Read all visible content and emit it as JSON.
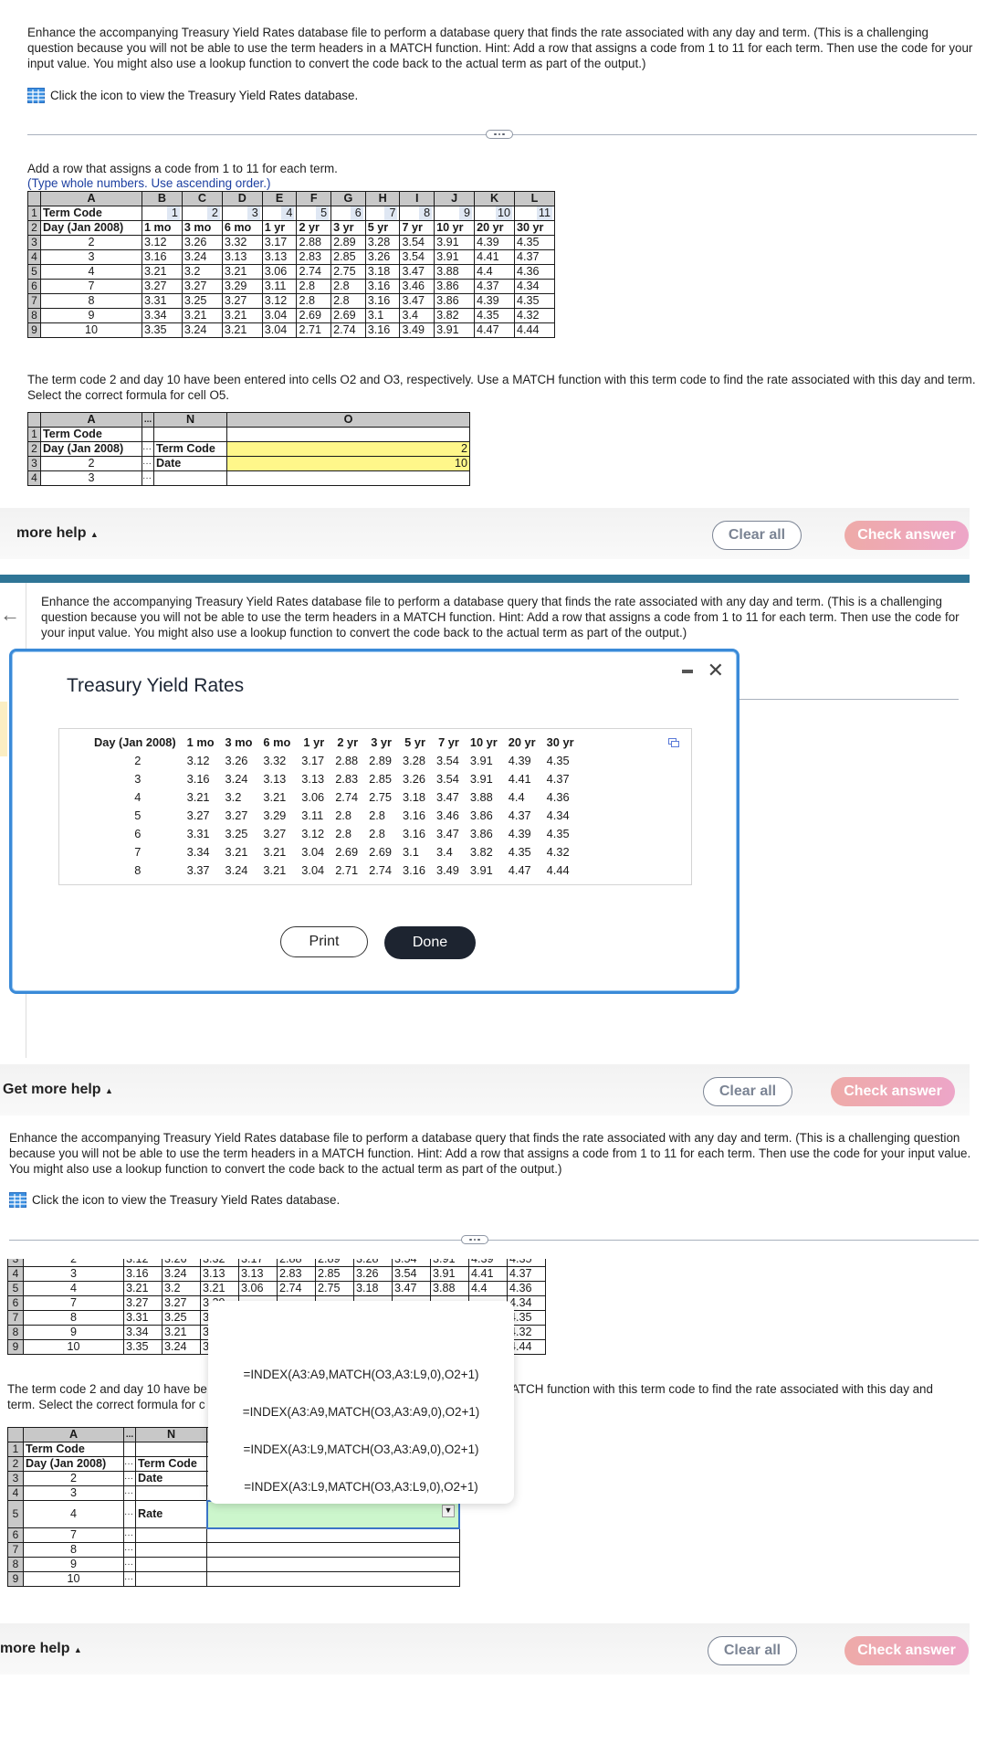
{
  "prompt": "Enhance the accompanying Treasury Yield Rates database file to perform a database query that finds the rate associated with any day and term. (This is a challenging question because you will not be able to use the term headers in a MATCH function. Hint: Add a row that assigns a code from 1 to 11 for each term. Then use the code for your input value. You might also use a lookup function to convert the code back to the actual term as part of the output.)",
  "db_link": "Click the icon to view the Treasury Yield Rates database.",
  "step1": {
    "instruction": "Add a row that assigns a code from 1 to 11 for each term.",
    "hint": "(Type whole numbers. Use ascending order.)",
    "columns": [
      "A",
      "B",
      "C",
      "D",
      "E",
      "F",
      "G",
      "H",
      "I",
      "J",
      "K",
      "L"
    ],
    "row1_label": "Term Code",
    "codes": [
      "1",
      "2",
      "3",
      "4",
      "5",
      "6",
      "7",
      "8",
      "9",
      "10",
      "11"
    ],
    "row2_label": "Day (Jan 2008)",
    "terms": [
      "1 mo",
      "3 mo",
      "6 mo",
      "1 yr",
      "2 yr",
      "3 yr",
      "5 yr",
      "7 yr",
      "10 yr",
      "20 yr",
      "30 yr"
    ],
    "rows": [
      {
        "n": "3",
        "day": "2",
        "v": [
          "3.12",
          "3.26",
          "3.32",
          "3.17",
          "2.88",
          "2.89",
          "3.28",
          "3.54",
          "3.91",
          "4.39",
          "4.35"
        ]
      },
      {
        "n": "4",
        "day": "3",
        "v": [
          "3.16",
          "3.24",
          "3.13",
          "3.13",
          "2.83",
          "2.85",
          "3.26",
          "3.54",
          "3.91",
          "4.41",
          "4.37"
        ]
      },
      {
        "n": "5",
        "day": "4",
        "v": [
          "3.21",
          "3.2",
          "3.21",
          "3.06",
          "2.74",
          "2.75",
          "3.18",
          "3.47",
          "3.88",
          "4.4",
          "4.36"
        ]
      },
      {
        "n": "6",
        "day": "7",
        "v": [
          "3.27",
          "3.27",
          "3.29",
          "3.11",
          "2.8",
          "2.8",
          "3.16",
          "3.46",
          "3.86",
          "4.37",
          "4.34"
        ]
      },
      {
        "n": "7",
        "day": "8",
        "v": [
          "3.31",
          "3.25",
          "3.27",
          "3.12",
          "2.8",
          "2.8",
          "3.16",
          "3.47",
          "3.86",
          "4.39",
          "4.35"
        ]
      },
      {
        "n": "8",
        "day": "9",
        "v": [
          "3.34",
          "3.21",
          "3.21",
          "3.04",
          "2.69",
          "2.69",
          "3.1",
          "3.4",
          "3.82",
          "4.35",
          "4.32"
        ]
      },
      {
        "n": "9",
        "day": "10",
        "v": [
          "3.35",
          "3.24",
          "3.21",
          "3.04",
          "2.71",
          "2.74",
          "3.16",
          "3.49",
          "3.91",
          "4.47",
          "4.44"
        ]
      }
    ]
  },
  "step2": {
    "instruction": "The term code 2 and day 10 have been entered into cells O2 and O3, respectively. Use a MATCH function with this term code to find the rate associated with this day and term. Select the correct formula for cell O5.",
    "instruction_visible_start": "The term code 2 and day 10 have be",
    "instruction_visible_end": "ATCH function with this term code to find the rate associated with this day and",
    "instruction_line2_start": "term. Select the correct formula for c",
    "col_a": "A",
    "col_dots": "...",
    "col_n": "N",
    "col_o": "O",
    "n_term_code": "Term Code",
    "n_date": "Date",
    "n_rate": "Rate",
    "o2": "2",
    "o3": "10",
    "a_labels": [
      "Term Code",
      "Day (Jan 2008)",
      "2",
      "3",
      "4",
      "7",
      "8",
      "9",
      "10"
    ]
  },
  "footer": {
    "help": "more help",
    "help_full": "Get more help",
    "clear": "Clear all",
    "check": "Check answer"
  },
  "modal": {
    "title": "Treasury Yield Rates",
    "header": [
      "Day (Jan 2008)",
      "1 mo",
      "3 mo",
      "6 mo",
      "1 yr",
      "2 yr",
      "3 yr",
      "5 yr",
      "7 yr",
      "10 yr",
      "20 yr",
      "30 yr"
    ],
    "rows": [
      [
        "2",
        "3.12",
        "3.26",
        "3.32",
        "3.17",
        "2.88",
        "2.89",
        "3.28",
        "3.54",
        "3.91",
        "4.39",
        "4.35"
      ],
      [
        "3",
        "3.16",
        "3.24",
        "3.13",
        "3.13",
        "2.83",
        "2.85",
        "3.26",
        "3.54",
        "3.91",
        "4.41",
        "4.37"
      ],
      [
        "4",
        "3.21",
        "3.2",
        "3.21",
        "3.06",
        "2.74",
        "2.75",
        "3.18",
        "3.47",
        "3.88",
        "4.4",
        "4.36"
      ],
      [
        "5",
        "3.27",
        "3.27",
        "3.29",
        "3.11",
        "2.8",
        "2.8",
        "3.16",
        "3.46",
        "3.86",
        "4.37",
        "4.34"
      ],
      [
        "6",
        "3.31",
        "3.25",
        "3.27",
        "3.12",
        "2.8",
        "2.8",
        "3.16",
        "3.47",
        "3.86",
        "4.39",
        "4.35"
      ],
      [
        "7",
        "3.34",
        "3.21",
        "3.21",
        "3.04",
        "2.69",
        "2.69",
        "3.1",
        "3.4",
        "3.82",
        "4.35",
        "4.32"
      ],
      [
        "8",
        "3.37",
        "3.24",
        "3.21",
        "3.04",
        "2.71",
        "2.74",
        "3.16",
        "3.49",
        "3.91",
        "4.47",
        "4.44"
      ]
    ],
    "print": "Print",
    "done": "Done"
  },
  "dropdown_options": [
    "=INDEX(A3:A9,MATCH(O3,A3:L9,0),O2+1)",
    "=INDEX(A3:A9,MATCH(O3,A3:A9,0),O2+1)",
    "=INDEX(A3:L9,MATCH(O3,A3:A9,0),O2+1)",
    "=INDEX(A3:L9,MATCH(O3,A3:L9,0),O2+1)"
  ],
  "colors": {
    "accent_bar": "#2f7596",
    "modal_border": "#3a8ad8",
    "input_yellow": "#fff78a",
    "input_green": "#ccf6cc",
    "check_answer": "#eda6c8"
  }
}
